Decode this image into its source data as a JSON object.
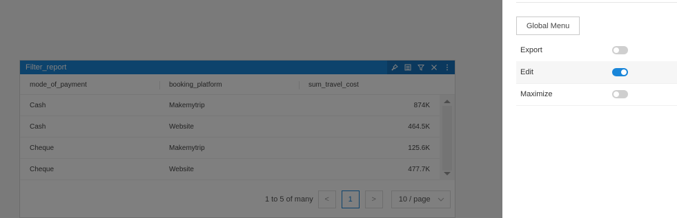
{
  "widget": {
    "title": "Filter_report",
    "tools": [
      "pin-icon",
      "list-icon",
      "filter-icon",
      "close-icon",
      "more-icon"
    ]
  },
  "table": {
    "columns": [
      "mode_of_payment",
      "booking_platform",
      "sum_travel_cost"
    ],
    "rows": [
      [
        "Cash",
        "Makemytrip",
        "874K"
      ],
      [
        "Cash",
        "Website",
        "464.5K"
      ],
      [
        "Cheque",
        "Makemytrip",
        "125.6K"
      ],
      [
        "Cheque",
        "Website",
        "477.7K"
      ]
    ]
  },
  "pager": {
    "info": "1 to 5 of many",
    "prev": "<",
    "current": "1",
    "next": ">",
    "page_size": "10 / page"
  },
  "panel": {
    "global_menu_label": "Global Menu",
    "options": [
      {
        "label": "Export",
        "enabled": false
      },
      {
        "label": "Edit",
        "enabled": true
      },
      {
        "label": "Maximize",
        "enabled": false
      }
    ]
  },
  "colors": {
    "accent": "#1a86d9",
    "header_dark": "#1773bd"
  }
}
